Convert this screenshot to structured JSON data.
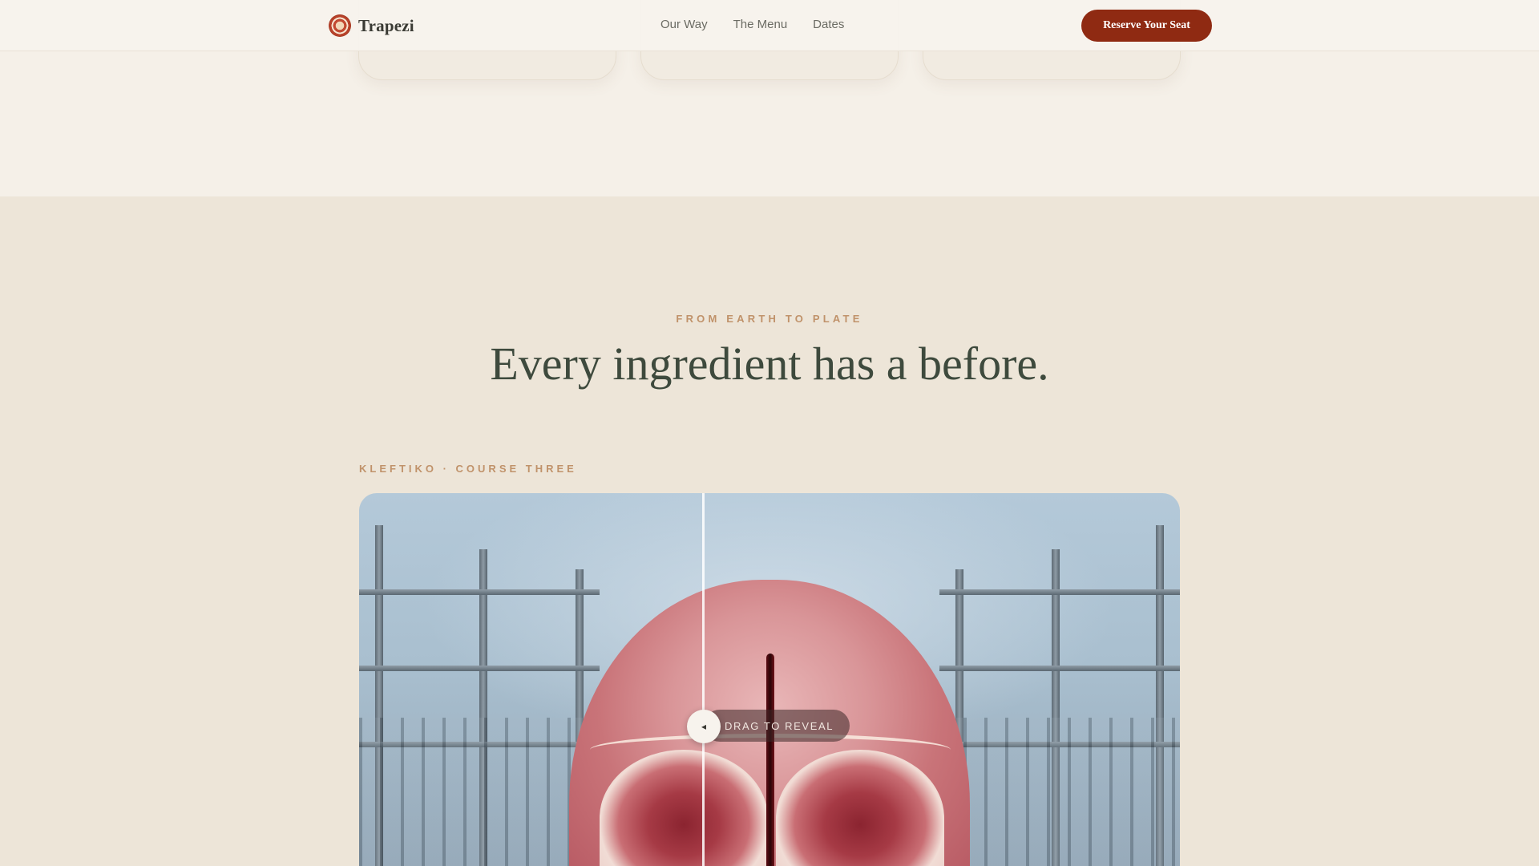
{
  "header": {
    "brand_name": "Trapezi",
    "nav": [
      {
        "label": "Our Way"
      },
      {
        "label": "The Menu"
      },
      {
        "label": "Dates"
      }
    ],
    "cta_label": "Reserve Your Seat"
  },
  "section": {
    "eyebrow": "FROM EARTH TO PLATE",
    "headline": "Every ingredient has a before.",
    "course_label": "KLEFTIKO · COURSE THREE"
  },
  "compare": {
    "handle_icon": "◂",
    "hint": "DRAG TO REVEAL"
  },
  "colors": {
    "cta_bg": "#8f2a12",
    "accent_text": "#c0926a",
    "headline": "#3e4a3d",
    "page_bg": "#ede5d8",
    "top_band_bg": "#f5f0e8"
  }
}
